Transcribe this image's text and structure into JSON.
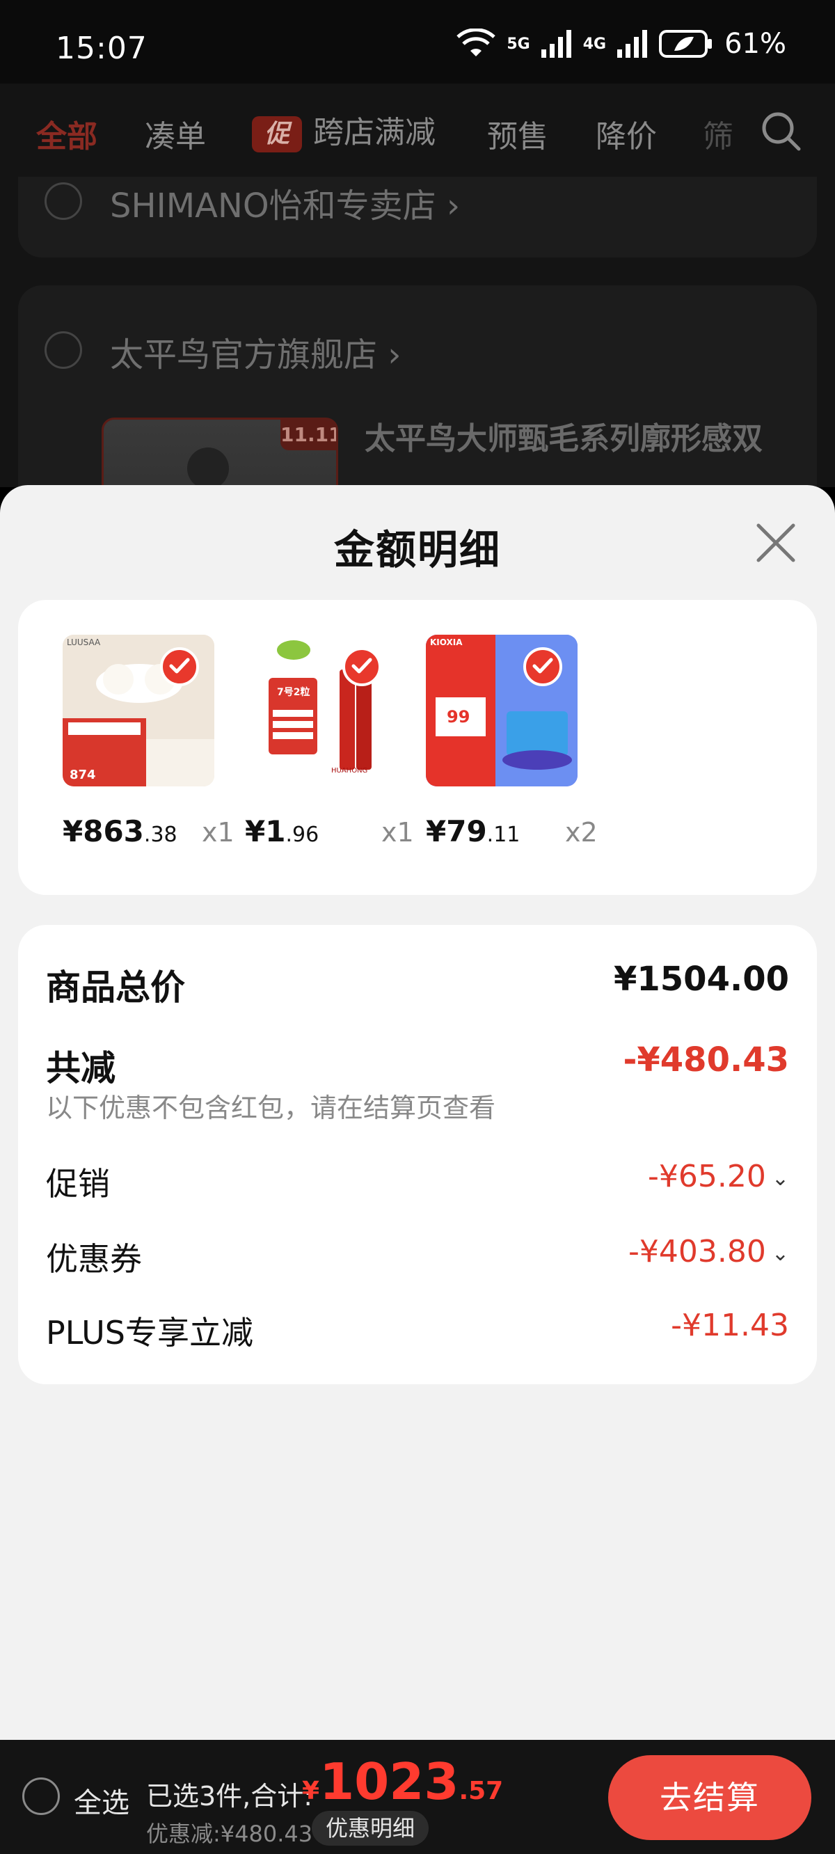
{
  "status_bar": {
    "time": "15:07",
    "battery": "61%",
    "net_5g": "5G",
    "net_4g": "4G"
  },
  "top_tabs": {
    "all": "全部",
    "bundle": "凑单",
    "promo_badge": "促",
    "cross_store": "跨店满减",
    "presale": "预售",
    "price_drop": "降价",
    "filter_partial": "筛"
  },
  "background": {
    "shop1_name": "SHIMANO怡和专卖店",
    "shop2_name": "太平鸟官方旗舰店",
    "product_tag": "11.11",
    "product_title": "太平鸟大师甄毛系列廓形感双"
  },
  "sheet": {
    "title": "金额明细",
    "items": [
      {
        "price_int": "¥863",
        "price_dec": ".38",
        "qty": "x1",
        "thumb_text_1": "LUUSAA",
        "thumb_text_2": "874"
      },
      {
        "price_int": "¥1",
        "price_dec": ".96",
        "qty": "x1",
        "thumb_text_1": "7号2粒",
        "thumb_text_2": "HUAHONG"
      },
      {
        "price_int": "¥79",
        "price_dec": ".11",
        "qty": "x2",
        "thumb_text_1": "KIOXIA",
        "thumb_text_2": "99"
      }
    ],
    "summary": {
      "total_label": "商品总价",
      "total_value": "¥1504.00",
      "reduce_label": "共减",
      "reduce_value": "-¥480.43",
      "note": "以下优惠不包含红包，请在结算页查看",
      "promo_label": "促销",
      "promo_value": "-¥65.20",
      "coupon_label": "优惠券",
      "coupon_value": "-¥403.80",
      "plus_label": "PLUS专享立减",
      "plus_value": "-¥11.43"
    }
  },
  "bottom_bar": {
    "select_all": "全选",
    "selected_count": "已选3件,合计:",
    "currency": "¥",
    "total_int": "1023",
    "total_dec": ".57",
    "discount": "优惠减:¥480.43",
    "detail_button": "优惠明细",
    "checkout": "去结算"
  },
  "colors": {
    "accent": "#e8382c",
    "checkout_bg": "#ec4a3f",
    "sheet_bg": "#f2f2f2"
  }
}
